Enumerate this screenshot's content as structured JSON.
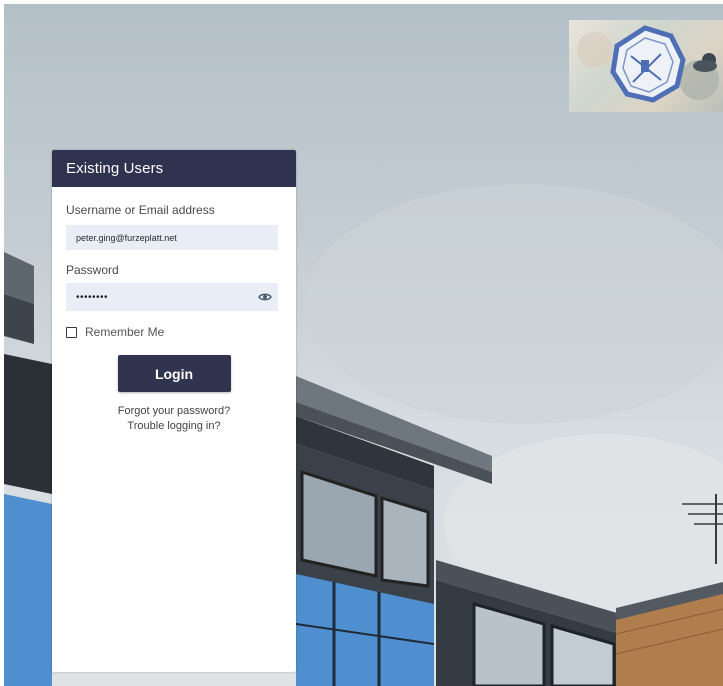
{
  "card": {
    "title": "Existing Users",
    "username_label": "Username or Email address",
    "username_value": "peter.ging@furzeplatt.net",
    "password_label": "Password",
    "password_value": "••••••••",
    "remember_label": "Remember Me",
    "remember_checked": false,
    "login_label": "Login",
    "forgot_link": "Forgot your password?",
    "trouble_link": "Trouble logging in?"
  },
  "icons": {
    "password_toggle": "eye-icon",
    "logo": "school-crest-logo"
  },
  "colors": {
    "header_bg": "#2f3350",
    "button_bg": "#30344f",
    "input_bg": "#e8edf6",
    "eye_icon": "#4a5a6e"
  }
}
